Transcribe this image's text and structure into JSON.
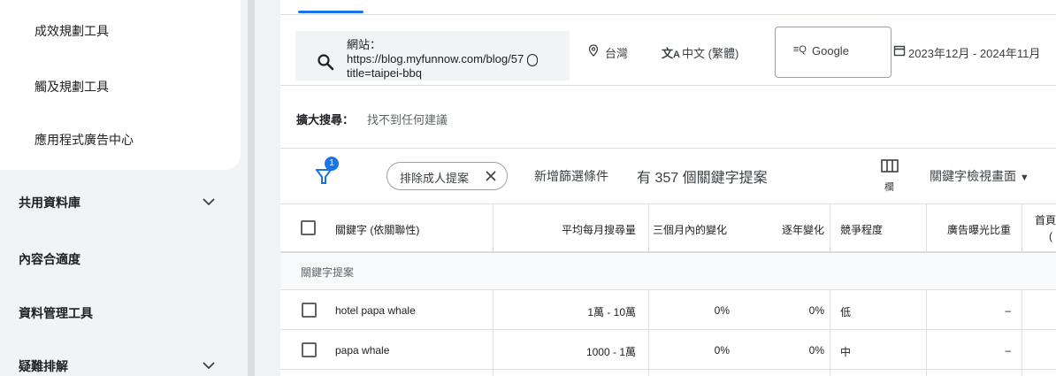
{
  "sidebar": {
    "sub_items": [
      {
        "label": "成效規劃工具"
      },
      {
        "label": "觸及規劃工具"
      },
      {
        "label": "應用程式廣告中心"
      }
    ],
    "sections": [
      {
        "label": "共用資料庫",
        "expandable": true
      },
      {
        "label": "內容合適度",
        "expandable": false
      },
      {
        "label": "資料管理工具",
        "expandable": false
      },
      {
        "label": "疑難排解",
        "expandable": true
      }
    ]
  },
  "filters": {
    "url_label": "網站：",
    "url_value": "https://blog.myfunnow.com/blog/57",
    "url_value_2": "title=taipei-bbq",
    "location": "台灣",
    "language": "中文 (繁體)",
    "network": "Google",
    "date_range": "2023年12月 - 2024年11月"
  },
  "broaden": {
    "label": "擴大搜尋：",
    "value": "找不到任何建議"
  },
  "toolbar": {
    "filter_badge": "1",
    "chip_label": "排除成人提案",
    "add_filter": "新增篩選條件",
    "result_summary": "有 357 個關鍵字提案",
    "columns_label": "欄",
    "view_select": "關鍵字檢視畫面"
  },
  "table": {
    "headers": {
      "keyword": "關鍵字 (依關聯性)",
      "avg_monthly": "平均每月搜尋量",
      "three_month": "三個月內的變化",
      "yoy": "逐年變化",
      "competition": "競爭程度",
      "impression_share": "廣告曝光比重",
      "top_bid": "首頁"
    },
    "group_label": "關鍵字提案",
    "rows": [
      {
        "keyword": "hotel papa whale",
        "avg_monthly": "1萬 - 10萬",
        "three_month": "0%",
        "yoy": "0%",
        "competition": "低",
        "impression_share": "–"
      },
      {
        "keyword": "papa whale",
        "avg_monthly": "1000 - 1萬",
        "three_month": "0%",
        "yoy": "0%",
        "competition": "中",
        "impression_share": "–"
      }
    ]
  },
  "colors": {
    "accent": "#1a73e8",
    "divider": "#e0e0e0"
  }
}
